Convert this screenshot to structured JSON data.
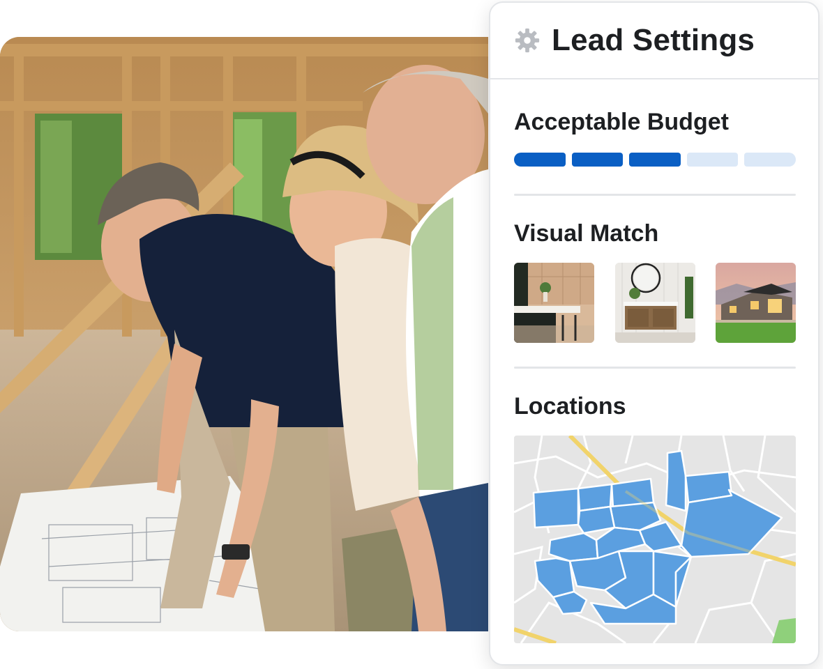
{
  "card": {
    "title": "Lead Settings",
    "header_icon": "gear-icon"
  },
  "budget": {
    "title": "Acceptable Budget",
    "segments_total": 5,
    "segments_filled": 3,
    "filled_color": "#0a5fc4",
    "empty_color": "#dbe8f7"
  },
  "visual_match": {
    "title": "Visual Match",
    "images": [
      "kitchen-image",
      "bathroom-vanity-image",
      "house-exterior-image"
    ]
  },
  "locations": {
    "title": "Locations",
    "region_color": "#5b9fe0"
  },
  "photo": {
    "subject": "builder-clients-reviewing-blueprints-photo"
  }
}
